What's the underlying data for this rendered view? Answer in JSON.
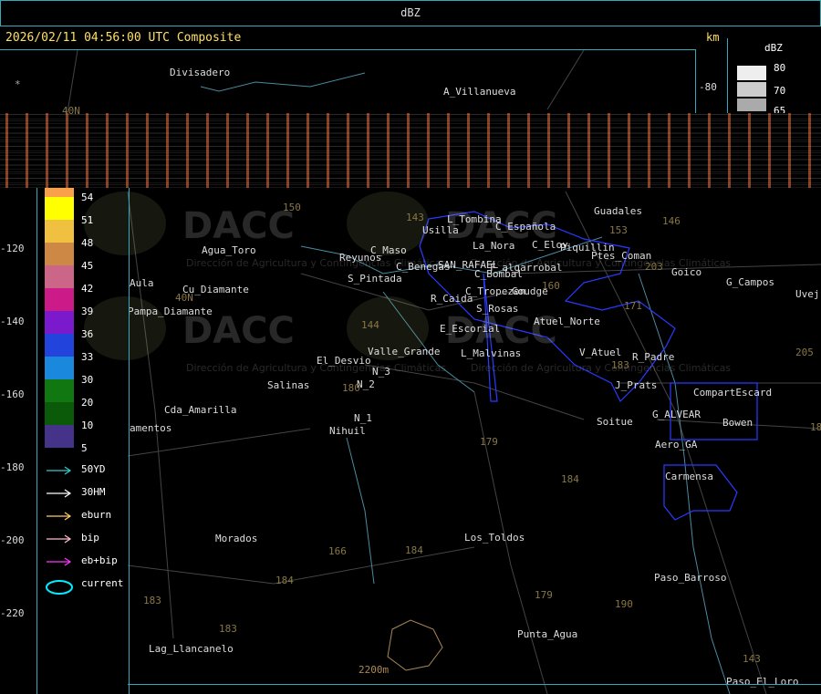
{
  "window": {
    "title": "dBZ"
  },
  "header": {
    "timestamp": "2026/02/11 04:56:00 UTC Composite",
    "unit": "km"
  },
  "scale_top": {
    "title": "dBZ",
    "values": [
      "80",
      "70",
      "65"
    ]
  },
  "right_ticks": [
    "-80"
  ],
  "colorbar": [
    {
      "label": "54",
      "color": "#f9a04a"
    },
    {
      "label": "51",
      "color": "#ffff00"
    },
    {
      "label": "48",
      "color": "#f0c040"
    },
    {
      "label": "45",
      "color": "#cc8844"
    },
    {
      "label": "42",
      "color": "#cc6688"
    },
    {
      "label": "39",
      "color": "#cc1a88"
    },
    {
      "label": "36",
      "color": "#7a1acc"
    },
    {
      "label": "33",
      "color": "#2244dd"
    },
    {
      "label": "30",
      "color": "#1a88dd"
    },
    {
      "label": "20",
      "color": "#117711"
    },
    {
      "label": "10",
      "color": "#0a5a0a"
    },
    {
      "label": "5",
      "color": "#443388"
    }
  ],
  "tracks": [
    {
      "label": "50YD",
      "color": "#33cccc"
    },
    {
      "label": "30HM",
      "color": "#ffffff"
    },
    {
      "label": "eburn",
      "color": "#ffcc66"
    },
    {
      "label": "bip",
      "color": "#ffbbcc"
    },
    {
      "label": "eb+bip",
      "color": "#ff33ff"
    },
    {
      "label": "current",
      "color": "#00eeff"
    }
  ],
  "y_ticks": [
    "-120",
    "-140",
    "-160",
    "-180",
    "-200",
    "-220"
  ],
  "watermark": {
    "brand": "DACC",
    "subtitle": "Dirección de Agricultura y Contingencias Climáticas"
  },
  "places": [
    "Divisadero",
    "A_Villanueva",
    "Usilla",
    "L_Tombina",
    "C_Española",
    "Guadales",
    "C_Eloy",
    "La_Nora",
    "Piquillin",
    "Ptes_Coman",
    "Agua_Toro",
    "Reyunos",
    "C_Maso",
    "C_Benegas",
    "SAN_RAFAEL",
    "F_algarrobal",
    "Goico",
    "G_Campos",
    "Uvej",
    "Aula",
    "Cu_Diamante",
    "S_Pintada",
    "C_Bombal",
    "Pampa_Diamante",
    "R_Caida",
    "C_Tropezon",
    "Goudge",
    "S_Rosas",
    "Atuel_Norte",
    "E_Escorial",
    "Valle_Grande",
    "L_Malvinas",
    "V_Atuel",
    "R_Padre",
    "El_Desvio",
    "N_3",
    "N_2",
    "Salinas",
    "J_Prats",
    "CompartEscard",
    "Cda_Amarilla",
    "G_ALVEAR",
    "Bowen",
    "N_1",
    "Soitue",
    "Nihuil",
    "Aero_GA",
    "amentos",
    "Carmensa",
    "Morados",
    "Los_Toldos",
    "Paso_Barroso",
    "Punta_Agua",
    "Lag_Llancanelo",
    "Paso_El_Loro",
    "2200m"
  ],
  "numbers": [
    "150",
    "143",
    "153",
    "146",
    "203",
    "160",
    "171",
    "144",
    "183",
    "180",
    "179",
    "184",
    "205",
    "183",
    "166",
    "184",
    "184",
    "179",
    "190",
    "143",
    "183",
    "18"
  ],
  "misc": {
    "lat1": "40N",
    "lat2": "40N",
    "star": "*"
  }
}
